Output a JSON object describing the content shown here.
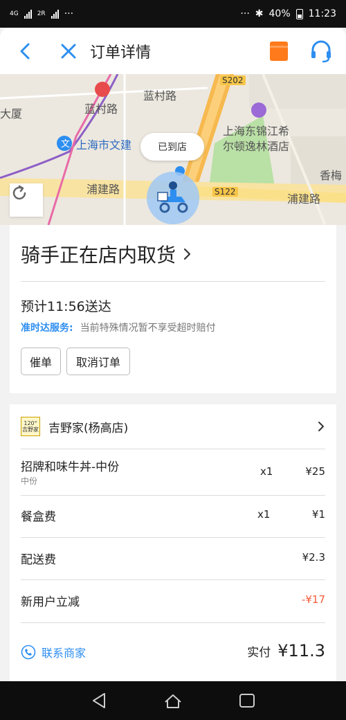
{
  "status_bar": {
    "network": "4G",
    "sim1": "1",
    "sim2": "2R",
    "dots_left": "···",
    "dots_right": "···",
    "battery": "40%",
    "time": "11:23"
  },
  "header": {
    "title": "订单详情"
  },
  "map": {
    "labels": {
      "road1": "蓝村路",
      "road2": "蓝村路",
      "highway1": "S202",
      "building1": "大厦",
      "poi1": "上海市文建",
      "hotel1": "上海东锦江希",
      "hotel2": "尔顿逸林酒店",
      "road3": "浦建路",
      "road4": "浦建路",
      "highway2": "S122",
      "right_edge": "香梅",
      "metro_mark": "文"
    },
    "bubble": "已到店"
  },
  "status": {
    "title": "骑手正在店内取货",
    "eta": "预计11:56送达",
    "ontime_label": "准时达服务:",
    "ontime_text": "当前特殊情况暂不享受超时赔付",
    "urge_button": "催单",
    "cancel_button": "取消订单"
  },
  "order": {
    "shop_logo_top": "120°",
    "shop_logo_bottom": "吉野家",
    "shop_name": "吉野家(杨高店)",
    "items": [
      {
        "name": "招牌和味牛丼-中份",
        "sub": "中份",
        "qty": "x1",
        "price": "¥25"
      },
      {
        "name": "餐盒费",
        "qty": "x1",
        "price": "¥1"
      },
      {
        "name": "配送费",
        "price": "¥2.3"
      },
      {
        "name": "新用户立减",
        "price": "-¥17"
      }
    ],
    "contact_label": "联系商家",
    "paid_label": "实付",
    "paid_value": "¥11.3"
  },
  "colors": {
    "accent_blue": "#2d8ef0",
    "discount_red": "#f25a3a",
    "wallet_orange": "#ff7a1a"
  },
  "icons": [
    "back-icon",
    "close-icon",
    "wallet-icon",
    "headset-icon",
    "refresh-icon",
    "chevron-right-icon",
    "phone-icon",
    "nav-back-icon",
    "nav-home-icon",
    "nav-recents-icon"
  ]
}
